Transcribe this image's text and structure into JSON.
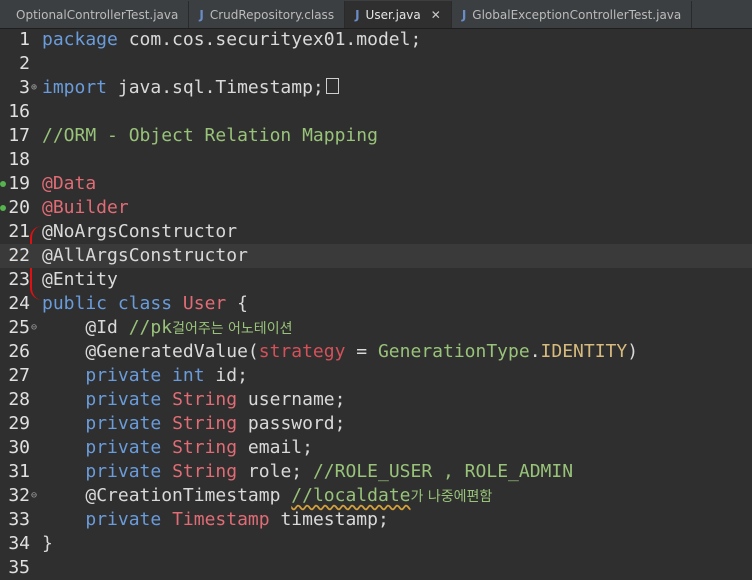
{
  "tabs": [
    {
      "label": "OptionalControllerTest.java",
      "icon": "java-file-icon"
    },
    {
      "label": "CrudRepository.class",
      "icon": "class-file-icon"
    },
    {
      "label": "User.java",
      "icon": "java-file-icon",
      "active": true
    },
    {
      "label": "GlobalExceptionControllerTest.java",
      "icon": "java-file-icon"
    }
  ],
  "lines": [
    {
      "no": "1"
    },
    {
      "no": "2"
    },
    {
      "no": "3"
    },
    {
      "no": "16"
    },
    {
      "no": "17"
    },
    {
      "no": "18"
    },
    {
      "no": "19"
    },
    {
      "no": "20"
    },
    {
      "no": "21"
    },
    {
      "no": "22"
    },
    {
      "no": "23"
    },
    {
      "no": "24"
    },
    {
      "no": "25"
    },
    {
      "no": "26"
    },
    {
      "no": "27"
    },
    {
      "no": "28"
    },
    {
      "no": "29"
    },
    {
      "no": "30"
    },
    {
      "no": "31"
    },
    {
      "no": "32"
    },
    {
      "no": "33"
    },
    {
      "no": "34"
    },
    {
      "no": "35"
    }
  ],
  "code": {
    "l1_kw": "package",
    "l1_rest": " com.cos.securityex01.model;",
    "l3_kw": "import",
    "l3_rest": " java.sql.Timestamp;",
    "l17": "//ORM - Object Relation Mapping",
    "l19": "@Data",
    "l20": "@Builder",
    "l21": "@NoArgsConstructor",
    "l22": "@AllArgsConstructor",
    "l23": "@Entity",
    "l24_kw": "public class",
    "l24_cls": "User",
    "l24_rest": " {",
    "l25_ann": "@Id",
    "l25_cmt": "//pk",
    "l25_ko": "걸어주는 어노테이션",
    "l26_ann": "@GeneratedValue(",
    "l26_param": "strategy",
    "l26_eq": " = ",
    "l26_type": "GenerationType",
    "l26_dot": ".",
    "l26_enum": "IDENTITY",
    "l26_close": ")",
    "l27_kw": "private int",
    "l27_rest": " id;",
    "l28_kw": "private",
    "l28_type": "String",
    "l28_rest": " username;",
    "l29_kw": "private",
    "l29_type": "String",
    "l29_rest": " password;",
    "l30_kw": "private",
    "l30_type": "String",
    "l30_rest": " email;",
    "l31_kw": "private",
    "l31_type": "String",
    "l31_rest": " role;",
    "l31_cmt": "//ROLE_USER , ROLE_ADMIN",
    "l32_ann": "@CreationTimestamp",
    "l32_cmt": "//localdate",
    "l32_ko": "가 나중에편함",
    "l33_kw": "private",
    "l33_type": "Timestamp",
    "l33_rest": " timestamp;",
    "l34": "}"
  }
}
